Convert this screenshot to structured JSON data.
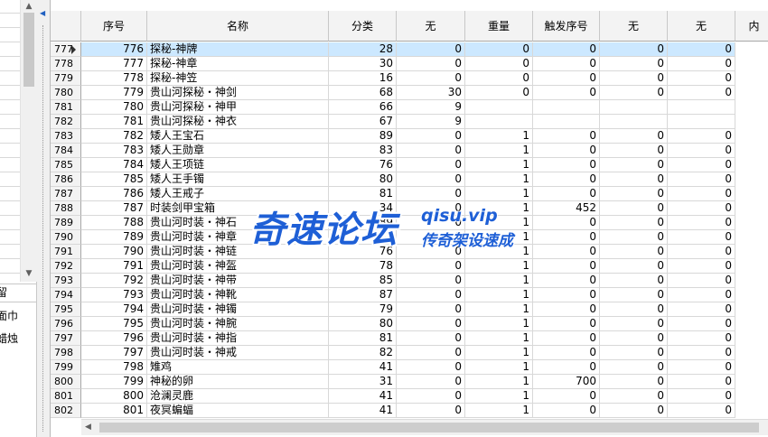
{
  "left_panel": {
    "header": "留",
    "items": [
      "面巾",
      "蜡烛"
    ]
  },
  "grid": {
    "columns": [
      "序号",
      "名称",
      "分类",
      "无",
      "重量",
      "触发序号",
      "无",
      "无",
      "内"
    ],
    "selected_row": 0,
    "rows": [
      [
        "777",
        "776",
        "探秘-神牌",
        "28",
        "0",
        "0",
        "0",
        "0",
        "0"
      ],
      [
        "778",
        "777",
        "探秘-神章",
        "30",
        "0",
        "0",
        "0",
        "0",
        "0"
      ],
      [
        "779",
        "778",
        "探秘-神笠",
        "16",
        "0",
        "0",
        "0",
        "0",
        "0"
      ],
      [
        "780",
        "779",
        "贵山河探秘・神剑",
        "68",
        "30",
        "0",
        "0",
        "0",
        "0"
      ],
      [
        "781",
        "780",
        "贵山河探秘・神甲",
        "66",
        "9",
        "",
        "",
        "",
        ""
      ],
      [
        "782",
        "781",
        "贵山河探秘・神衣",
        "67",
        "9",
        "",
        "",
        "",
        ""
      ],
      [
        "783",
        "782",
        "矮人王宝石",
        "89",
        "0",
        "1",
        "0",
        "0",
        "0"
      ],
      [
        "784",
        "783",
        "矮人王勋章",
        "83",
        "0",
        "1",
        "0",
        "0",
        "0"
      ],
      [
        "785",
        "784",
        "矮人王项链",
        "76",
        "0",
        "1",
        "0",
        "0",
        "0"
      ],
      [
        "786",
        "785",
        "矮人王手镯",
        "80",
        "0",
        "1",
        "0",
        "0",
        "0"
      ],
      [
        "787",
        "786",
        "矮人王戒子",
        "81",
        "0",
        "1",
        "0",
        "0",
        "0"
      ],
      [
        "788",
        "787",
        "时装剑甲宝箱",
        "34",
        "0",
        "1",
        "452",
        "0",
        "0"
      ],
      [
        "789",
        "788",
        "贵山河时装・神石",
        "89",
        "0",
        "1",
        "0",
        "0",
        "0"
      ],
      [
        "790",
        "789",
        "贵山河时装・神章",
        "83",
        "0",
        "1",
        "0",
        "0",
        "0"
      ],
      [
        "791",
        "790",
        "贵山河时装・神链",
        "76",
        "0",
        "1",
        "0",
        "0",
        "0"
      ],
      [
        "792",
        "791",
        "贵山河时装・神盔",
        "78",
        "0",
        "1",
        "0",
        "0",
        "0"
      ],
      [
        "793",
        "792",
        "贵山河时装・神带",
        "85",
        "0",
        "1",
        "0",
        "0",
        "0"
      ],
      [
        "794",
        "793",
        "贵山河时装・神靴",
        "87",
        "0",
        "1",
        "0",
        "0",
        "0"
      ],
      [
        "795",
        "794",
        "贵山河时装・神镯",
        "79",
        "0",
        "1",
        "0",
        "0",
        "0"
      ],
      [
        "796",
        "795",
        "贵山河时装・神腕",
        "80",
        "0",
        "1",
        "0",
        "0",
        "0"
      ],
      [
        "797",
        "796",
        "贵山河时装・神指",
        "81",
        "0",
        "1",
        "0",
        "0",
        "0"
      ],
      [
        "798",
        "797",
        "贵山河时装・神戒",
        "82",
        "0",
        "1",
        "0",
        "0",
        "0"
      ],
      [
        "799",
        "798",
        "雉鸡",
        "41",
        "0",
        "1",
        "0",
        "0",
        "0"
      ],
      [
        "800",
        "799",
        "神秘的卵",
        "31",
        "0",
        "1",
        "700",
        "0",
        "0"
      ],
      [
        "801",
        "800",
        "沧澜灵鹿",
        "41",
        "0",
        "1",
        "0",
        "0",
        "0"
      ],
      [
        "802",
        "801",
        "夜冥蝙蝠",
        "41",
        "0",
        "1",
        "0",
        "0",
        "0"
      ]
    ]
  },
  "watermark": {
    "main": "奇速论坛",
    "url": "qisu.vip",
    "sub": "传奇架设速成"
  },
  "colors": {
    "selection": "#cce8ff",
    "header_bg": "#f3f3f3",
    "watermark": "#1e5fd6"
  }
}
